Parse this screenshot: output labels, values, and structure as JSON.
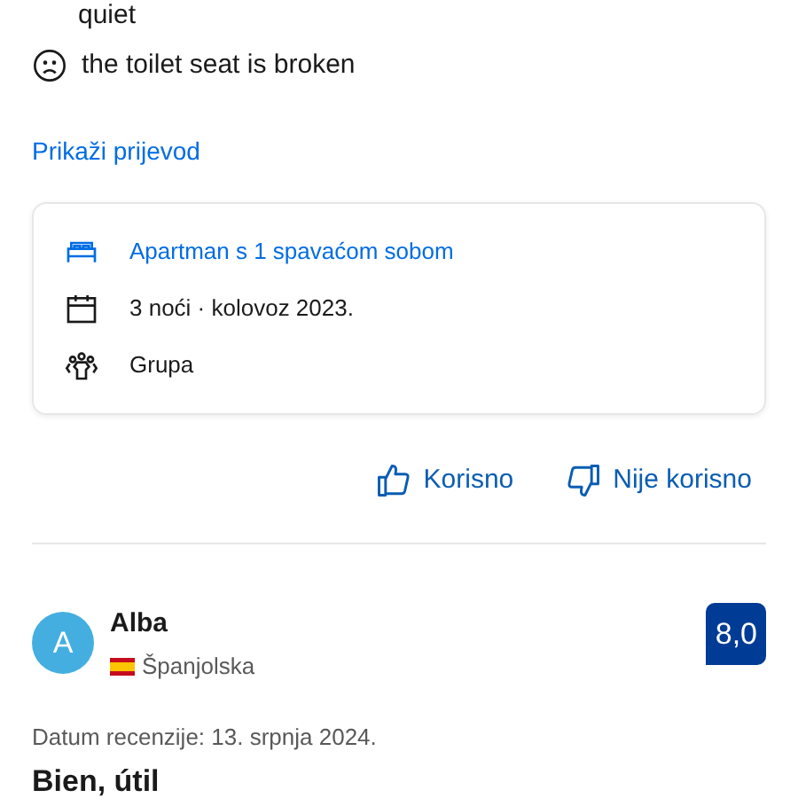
{
  "review_tail": {
    "positive_continuation": "quiet",
    "negative": "the toilet seat is broken"
  },
  "translate_link": "Prikaži prijevod",
  "stay_details": [
    {
      "kind": "room",
      "text": "Apartman s 1 spavaćom sobom"
    },
    {
      "kind": "dates",
      "text": "3 noći · kolovoz 2023."
    },
    {
      "kind": "group",
      "text": "Grupa"
    }
  ],
  "feedback_buttons": [
    {
      "kind": "helpful",
      "label": "Korisno"
    },
    {
      "kind": "not_helpful",
      "label": "Nije korisno"
    }
  ],
  "next_review": {
    "avatar_letter": "A",
    "name": "Alba",
    "country": "Španjolska",
    "score": "8,0",
    "date": "Datum recenzije: 13. srpnja 2024.",
    "title": "Bien, útil"
  }
}
